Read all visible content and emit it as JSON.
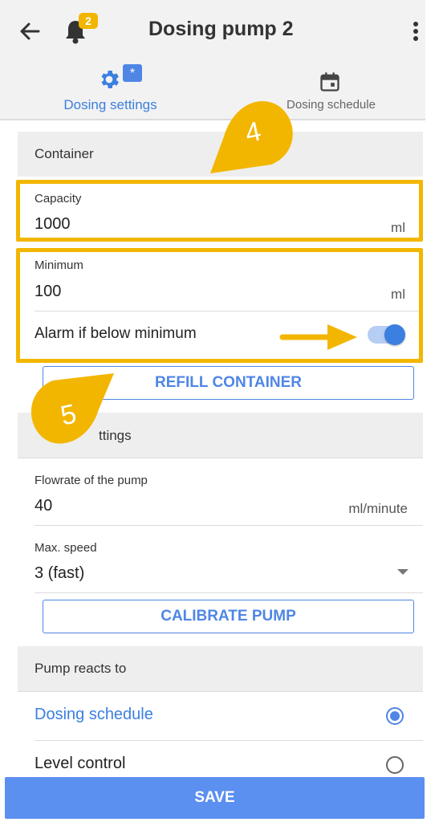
{
  "header": {
    "title": "Dosing pump 2",
    "notification_count": "2",
    "tabs": [
      {
        "label": "Dosing settings",
        "badge": "*",
        "active": true
      },
      {
        "label": "Dosing schedule",
        "active": false
      }
    ]
  },
  "container": {
    "heading": "Container",
    "capacity": {
      "label": "Capacity",
      "value": "1000",
      "unit": "ml"
    },
    "minimum": {
      "label": "Minimum",
      "value": "100",
      "unit": "ml"
    },
    "alarm": {
      "label": "Alarm if below minimum",
      "enabled": true
    },
    "refill_label": "REFILL CONTAINER"
  },
  "pump_settings": {
    "heading_visible": "ttings",
    "flowrate": {
      "label": "Flowrate of the pump",
      "value": "40",
      "unit": "ml/minute"
    },
    "max_speed": {
      "label": "Max. speed",
      "value": "3 (fast)"
    },
    "calibrate_label": "CALIBRATE PUMP"
  },
  "reacts_to": {
    "heading": "Pump reacts to",
    "options": [
      {
        "label": "Dosing schedule",
        "selected": true
      },
      {
        "label": "Level control",
        "selected": false
      }
    ]
  },
  "save_label": "SAVE",
  "annotations": [
    {
      "number": "4"
    },
    {
      "number": "5"
    }
  ],
  "colors": {
    "accent": "#3b7fe0",
    "highlight": "#f2b600",
    "save": "#5b8ff0"
  }
}
